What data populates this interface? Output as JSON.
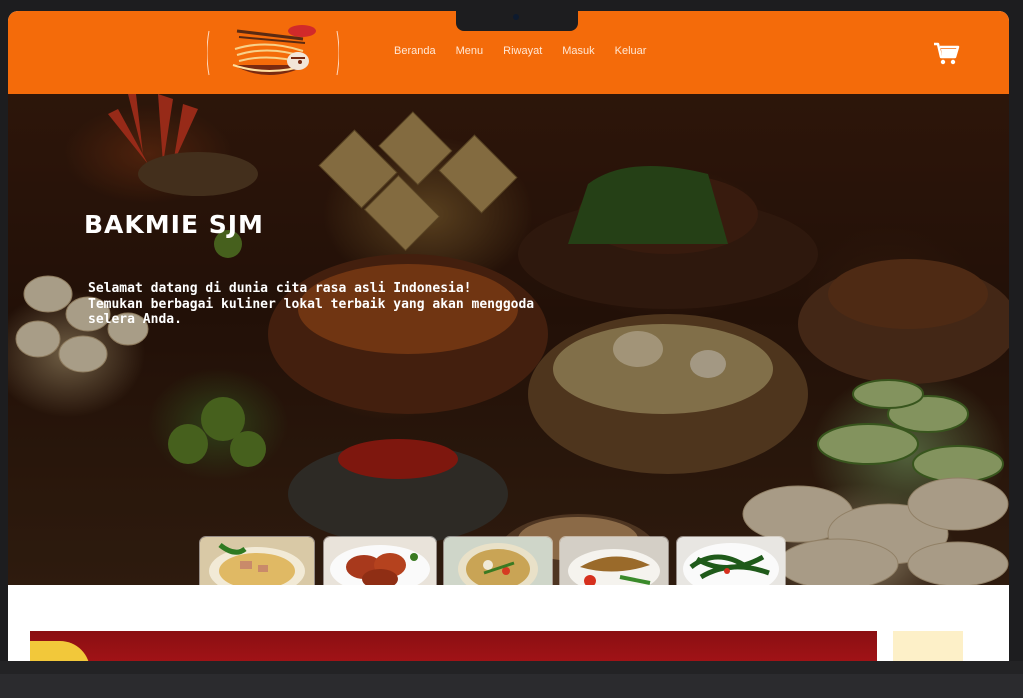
{
  "navbar": {
    "links": [
      "Beranda",
      "Menu",
      "Riwayat",
      "Masuk",
      "Keluar"
    ],
    "cart_icon": "shopping-cart-icon",
    "logo_icon": "noodle-bowl-logo",
    "background_color": "#f46b0a"
  },
  "hero": {
    "title": "BAKMIE SJM",
    "subtitle_lines": [
      "Selamat datang di dunia cita rasa asli Indonesia!",
      "Temukan berbagai kuliner lokal terbaik yang akan menggoda",
      "selera Anda."
    ],
    "thumbnails": [
      "mie-ayam-thumbnail",
      "ayam-bumbu-thumbnail",
      "soto-thumbnail",
      "pecel-lele-thumbnail",
      "kangkung-thumbnail"
    ]
  }
}
